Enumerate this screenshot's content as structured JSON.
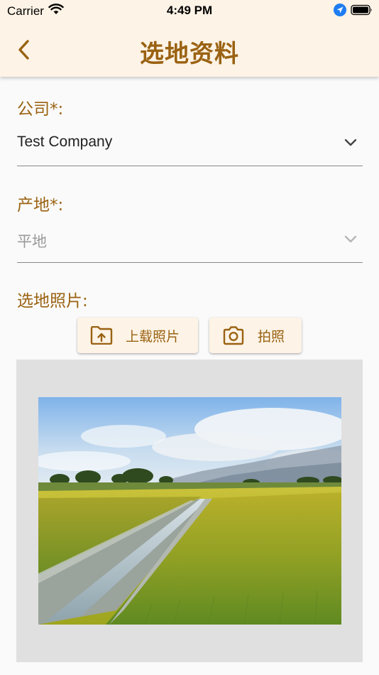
{
  "status_bar": {
    "carrier": "Carrier",
    "time": "4:49 PM"
  },
  "nav": {
    "title": "选地资料",
    "back_icon": "chevron-left-icon"
  },
  "form": {
    "company": {
      "label": "公司*:",
      "value": "Test Company"
    },
    "origin": {
      "label": "产地*:",
      "placeholder": "平地"
    },
    "photos": {
      "label": "选地照片:",
      "upload_label": "上载照片",
      "upload_icon": "upload-folder-icon",
      "camera_label": "拍照",
      "camera_icon": "camera-icon"
    }
  },
  "colors": {
    "accent": "#9a6212",
    "header_bg": "#fdf3e6",
    "page_bg": "#fafafa",
    "photo_bg": "#e0e0e0"
  }
}
